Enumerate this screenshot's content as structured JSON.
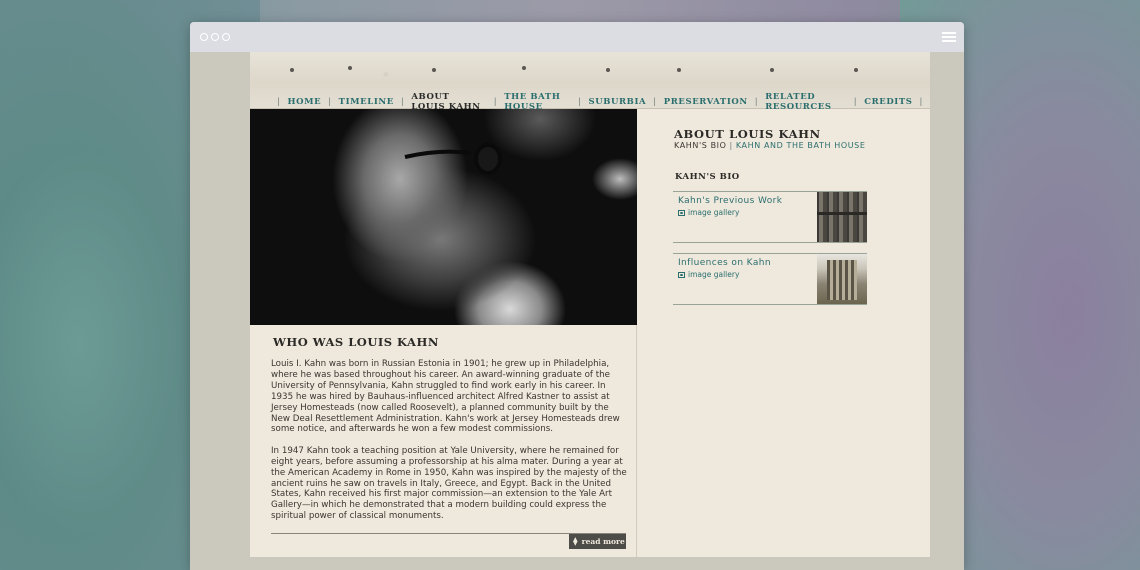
{
  "nav": {
    "items": [
      {
        "label": "HOME"
      },
      {
        "label": "TIMELINE"
      },
      {
        "label": "ABOUT LOUIS KAHN"
      },
      {
        "label": "THE BATH HOUSE"
      },
      {
        "label": "SUBURBIA"
      },
      {
        "label": "PRESERVATION"
      },
      {
        "label": "RELATED RESOURCES"
      },
      {
        "label": "CREDITS"
      }
    ],
    "separator": "|"
  },
  "left": {
    "heading": "WHO WAS LOUIS KAHN",
    "paragraphs": [
      "Louis I. Kahn was born in Russian Estonia in 1901; he grew up in Philadelphia, where he was based throughout his career. An award-winning graduate of the University of Pennsylvania, Kahn struggled to find work early in his career. In 1935 he was hired by Bauhaus-influenced architect Alfred Kastner to assist at Jersey Homesteads (now called Roosevelt), a planned community built by the New Deal Resettlement Administration. Kahn's work at Jersey Homesteads drew some notice, and afterwards he won a few modest commissions.",
      "In 1947 Kahn took a teaching position at Yale University, where he remained for eight years, before assuming a professorship at his alma mater. During a year at the American Academy in Rome in 1950, Kahn was inspired by the majesty of the ancient ruins he saw on travels in Italy, Greece, and Egypt. Back in the United States, Kahn received his first major commission—an extension to the Yale Art Gallery—in which he demonstrated that a modern building could express the spiritual power of classical monuments."
    ],
    "read_more": "read more"
  },
  "right": {
    "title": "ABOUT LOUIS KAHN",
    "subnav": {
      "current": "KAHN'S BIO",
      "separator": "|",
      "link": "KAHN AND THE BATH HOUSE"
    },
    "section_title": "KAHN'S BIO",
    "cards": [
      {
        "title": "Kahn's Previous Work",
        "gallery": "image gallery"
      },
      {
        "title": "Influences on Kahn",
        "gallery": "image gallery"
      }
    ]
  },
  "colors": {
    "link": "#2b6e6e",
    "text": "#3a3630",
    "page_bg": "#efe9dd",
    "button_bg": "#4e4c49"
  }
}
